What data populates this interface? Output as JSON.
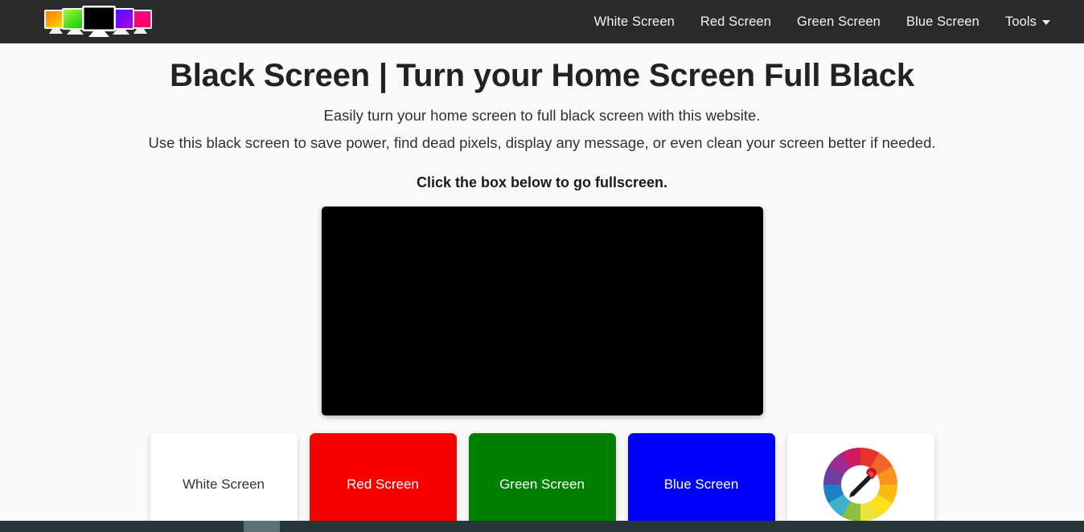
{
  "header": {
    "logo_name": "color-screens-logo",
    "logo_monitor_colors": [
      {
        "from": "#ff7a00",
        "to": "#ffe600"
      },
      {
        "from": "#9cff3a",
        "to": "#00c400"
      },
      {
        "from": "#000000",
        "to": "#000000"
      },
      {
        "from": "#3a16ff",
        "to": "#b400e6"
      },
      {
        "from": "#ff00a0",
        "to": "#ff0055"
      }
    ],
    "nav_items": [
      {
        "label": "White Screen",
        "name": "nav-white-screen"
      },
      {
        "label": "Red Screen",
        "name": "nav-red-screen"
      },
      {
        "label": "Green Screen",
        "name": "nav-green-screen"
      },
      {
        "label": "Blue Screen",
        "name": "nav-blue-screen"
      }
    ],
    "tools_label": "Tools",
    "background": "#2b2b2b"
  },
  "main": {
    "title": "Black Screen | Turn your Home Screen Full Black",
    "description_line_1": "Easily turn your home screen to full black screen with this website.",
    "description_line_2": "Use this black screen to save power, find dead pixels, display any message, or even clean your screen better if needed.",
    "instruction": "Click the box below to go fullscreen.",
    "fullscreen_box_color": "#000000"
  },
  "cards": [
    {
      "label": "White Screen",
      "bg": "#ffffff",
      "fg": "#333333",
      "name": "card-white-screen"
    },
    {
      "label": "Red Screen",
      "bg": "#fb0000",
      "fg": "#ffffff",
      "name": "card-red-screen"
    },
    {
      "label": "Green Screen",
      "bg": "#008000",
      "fg": "#ffffff",
      "name": "card-green-screen"
    },
    {
      "label": "Blue Screen",
      "bg": "#0000ff",
      "fg": "#ffffff",
      "name": "card-blue-screen"
    },
    {
      "label": "",
      "bg": "#ffffff",
      "fg": "#333333",
      "name": "card-color-picker",
      "icon": "color-wheel-eyedropper-icon"
    }
  ],
  "page": {
    "background": "#fafafa"
  }
}
